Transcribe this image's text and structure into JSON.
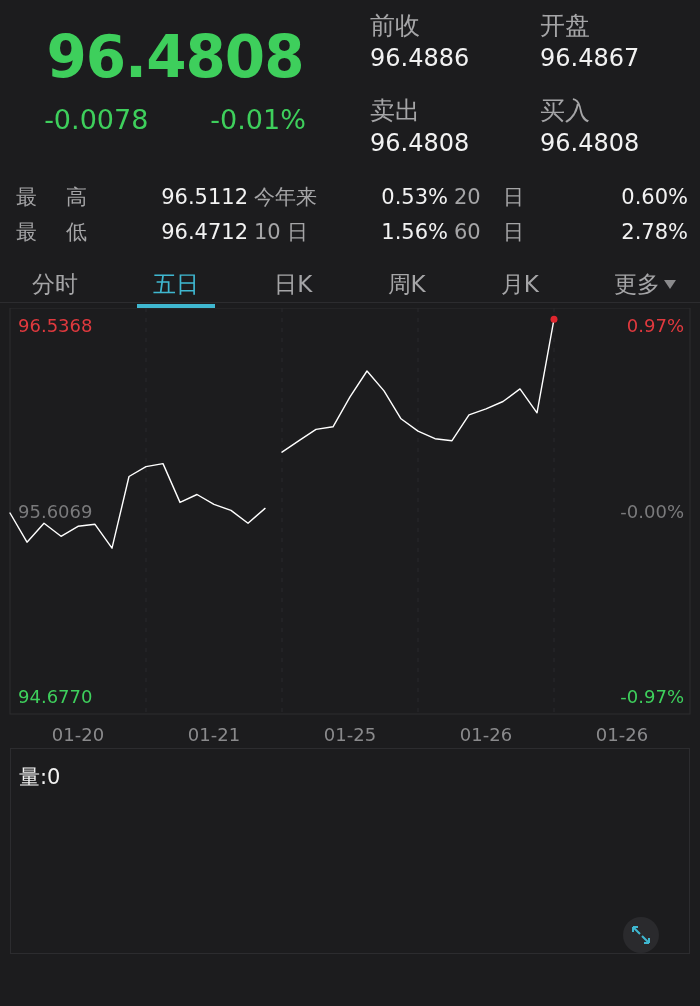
{
  "quote": {
    "price": "96.4808",
    "change": "-0.0078",
    "change_pct": "-0.01%",
    "color": "#3ecf5c"
  },
  "quote_fields": [
    {
      "label": "前收",
      "value": "96.4886"
    },
    {
      "label": "开盘",
      "value": "96.4867"
    },
    {
      "label": "卖出",
      "value": "96.4808"
    },
    {
      "label": "买入",
      "value": "96.4808"
    }
  ],
  "stats": [
    [
      "最 高",
      "96.5112",
      "今年来",
      "0.53%",
      "20 日",
      "0.60%"
    ],
    [
      "最 低",
      "96.4712",
      "10 日",
      "1.56%",
      "60 日",
      "2.78%"
    ]
  ],
  "tabs": [
    {
      "label": "分时",
      "selected": false
    },
    {
      "label": "五日",
      "selected": true
    },
    {
      "label": "日K",
      "selected": false
    },
    {
      "label": "周K",
      "selected": false
    },
    {
      "label": "月K",
      "selected": false
    },
    {
      "label": "更多",
      "selected": false,
      "dropdown": true
    }
  ],
  "axis_labels": [
    {
      "percent": "0.97%",
      "color": "#e0393e"
    },
    {
      "percent": "-0.00%",
      "color": "#7a7a7c"
    },
    {
      "percent": "-0.97%",
      "color": "#3ecf5c"
    }
  ],
  "price_chart": {
    "chart_data": {
      "type": "line",
      "grid": true,
      "ylim": [
        94.5873,
        96.6265
      ],
      "categories": [
        null,
        null,
        null,
        null,
        "01-20",
        null,
        null,
        null,
        null,
        null,
        null,
        null,
        "01-21",
        null,
        null,
        null,
        null,
        null,
        null,
        null,
        "01-25",
        null,
        null,
        null,
        null,
        null,
        null,
        null,
        "01-26",
        null,
        null,
        null,
        null,
        null,
        null,
        null,
        "01-26",
        null,
        null,
        null,
        null
      ],
      "yticks": [
        {
          "value": 94.677,
          "label": "94.6770"
        },
        {
          "value": 95.6069,
          "label": "95.6069"
        },
        {
          "value": 96.5368,
          "label": "96.5368"
        }
      ],
      "series": [
        {
          "color": "#ffffff",
          "values": [
            95.597,
            95.45,
            95.545,
            95.48,
            95.53,
            95.54,
            95.42,
            95.78,
            95.83,
            95.845,
            95.65,
            95.69,
            95.64,
            95.61,
            95.545,
            95.62,
            null,
            null,
            null,
            null,
            null,
            null,
            null,
            null,
            null,
            null,
            null,
            null,
            null,
            null,
            null,
            null,
            null,
            null,
            null,
            null,
            null,
            null,
            null,
            null,
            null
          ]
        },
        {
          "color": "#ffffff",
          "values": [
            null,
            null,
            null,
            null,
            null,
            null,
            null,
            null,
            null,
            null,
            null,
            null,
            null,
            null,
            null,
            null,
            95.902,
            95.96,
            96.017,
            96.03,
            96.18,
            96.31,
            96.21,
            96.07,
            96.008,
            95.97,
            95.96,
            96.09,
            96.12,
            96.157,
            96.22,
            96.1,
            96.57,
            null,
            null,
            null,
            null,
            null,
            null,
            null,
            null
          ]
        }
      ]
    }
  },
  "volume": {
    "label": "量:0"
  }
}
